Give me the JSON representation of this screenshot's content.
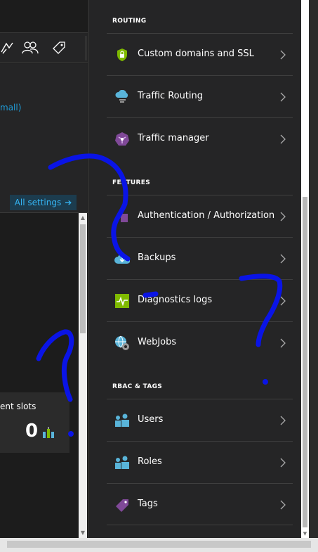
{
  "left_panel": {
    "size_link": "mall)",
    "all_settings_label": "All settings",
    "all_settings_arrow": "➔",
    "slots_label": "ent slots",
    "slots_count": "0"
  },
  "right_panel": {
    "sections": [
      {
        "header": "ROUTING",
        "items": [
          {
            "label": "Custom domains and SSL",
            "icon": "shield-lock-icon"
          },
          {
            "label": "Traffic Routing",
            "icon": "cloud-routing-icon"
          },
          {
            "label": "Traffic manager",
            "icon": "traffic-manager-icon"
          }
        ]
      },
      {
        "header": "FEATURES",
        "items": [
          {
            "label": "Authentication / Authorization",
            "icon": "key-icon"
          },
          {
            "label": "Backups",
            "icon": "cloud-backup-icon"
          },
          {
            "label": "Diagnostics logs",
            "icon": "pulse-icon"
          },
          {
            "label": "WebJobs",
            "icon": "globe-gear-icon"
          }
        ]
      },
      {
        "header": "RBAC & TAGS",
        "items": [
          {
            "label": "Users",
            "icon": "users-icon"
          },
          {
            "label": "Roles",
            "icon": "roles-icon"
          },
          {
            "label": "Tags",
            "icon": "tag-icon"
          }
        ]
      }
    ]
  },
  "colors": {
    "accent_link": "#1f9dd9",
    "annotation_ink": "#0a14e6"
  }
}
